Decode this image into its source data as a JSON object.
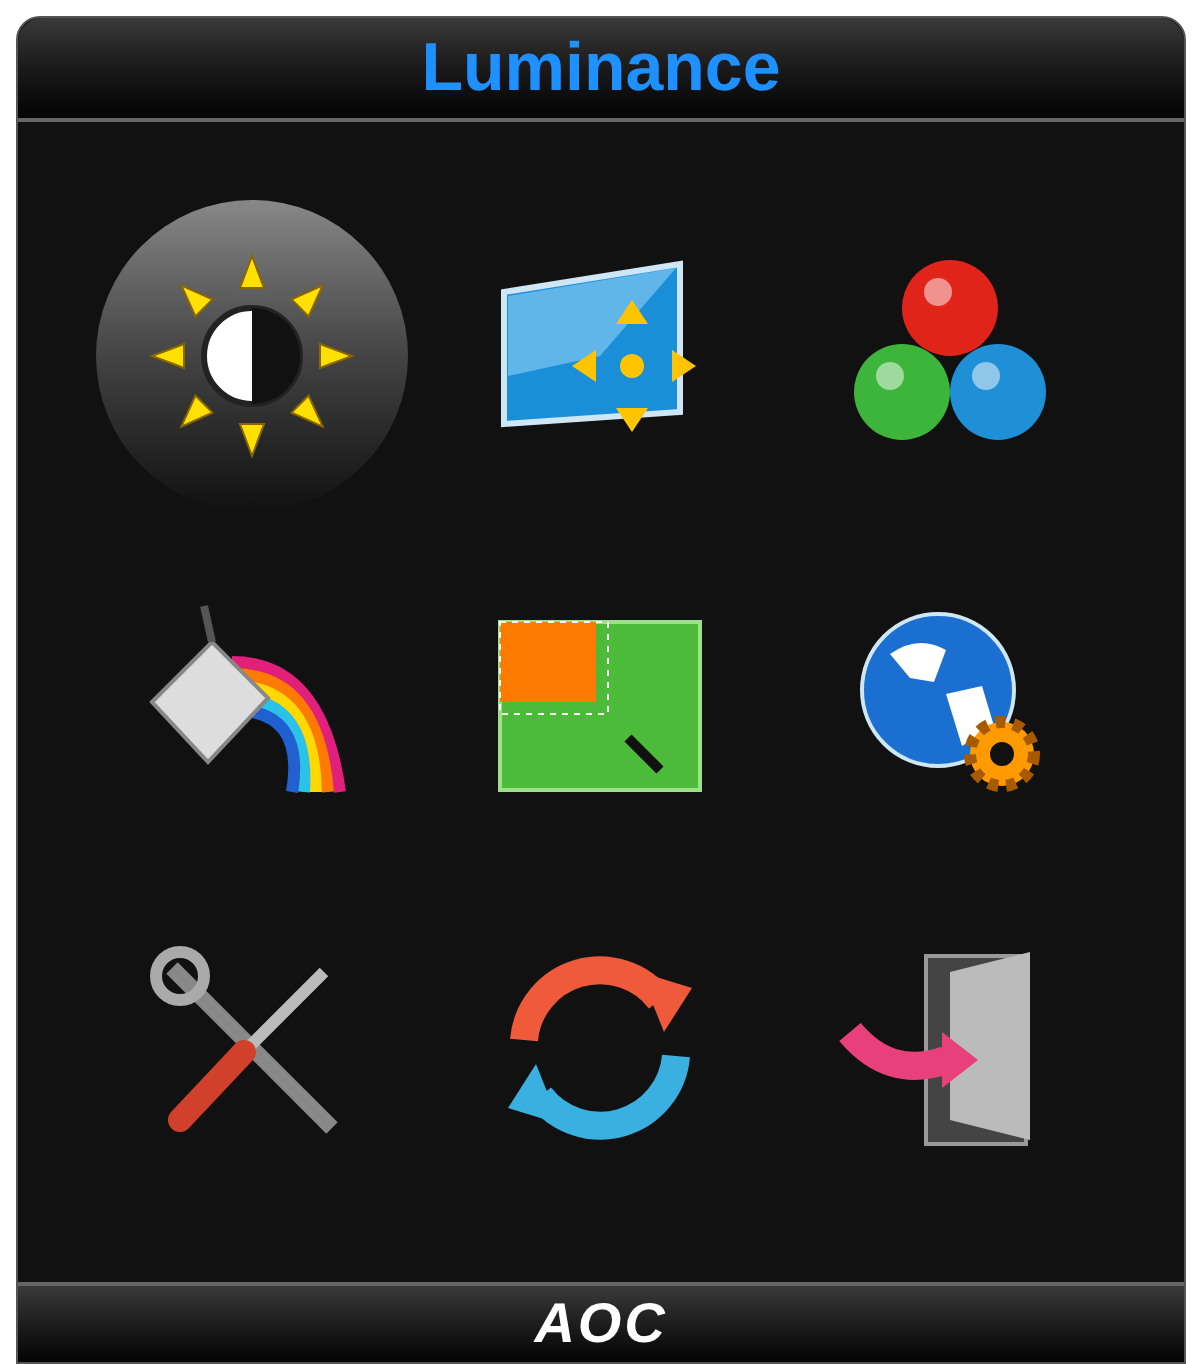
{
  "header": {
    "title": "Luminance"
  },
  "menu_items": [
    {
      "kind": "brightness",
      "selected": true
    },
    {
      "kind": "position",
      "selected": false
    },
    {
      "kind": "color",
      "selected": false
    },
    {
      "kind": "rainbow",
      "selected": false
    },
    {
      "kind": "window",
      "selected": false
    },
    {
      "kind": "globe",
      "selected": false
    },
    {
      "kind": "tools",
      "selected": false
    },
    {
      "kind": "refresh",
      "selected": false
    },
    {
      "kind": "exit",
      "selected": false
    }
  ],
  "footer": {
    "brand": "AOC"
  }
}
